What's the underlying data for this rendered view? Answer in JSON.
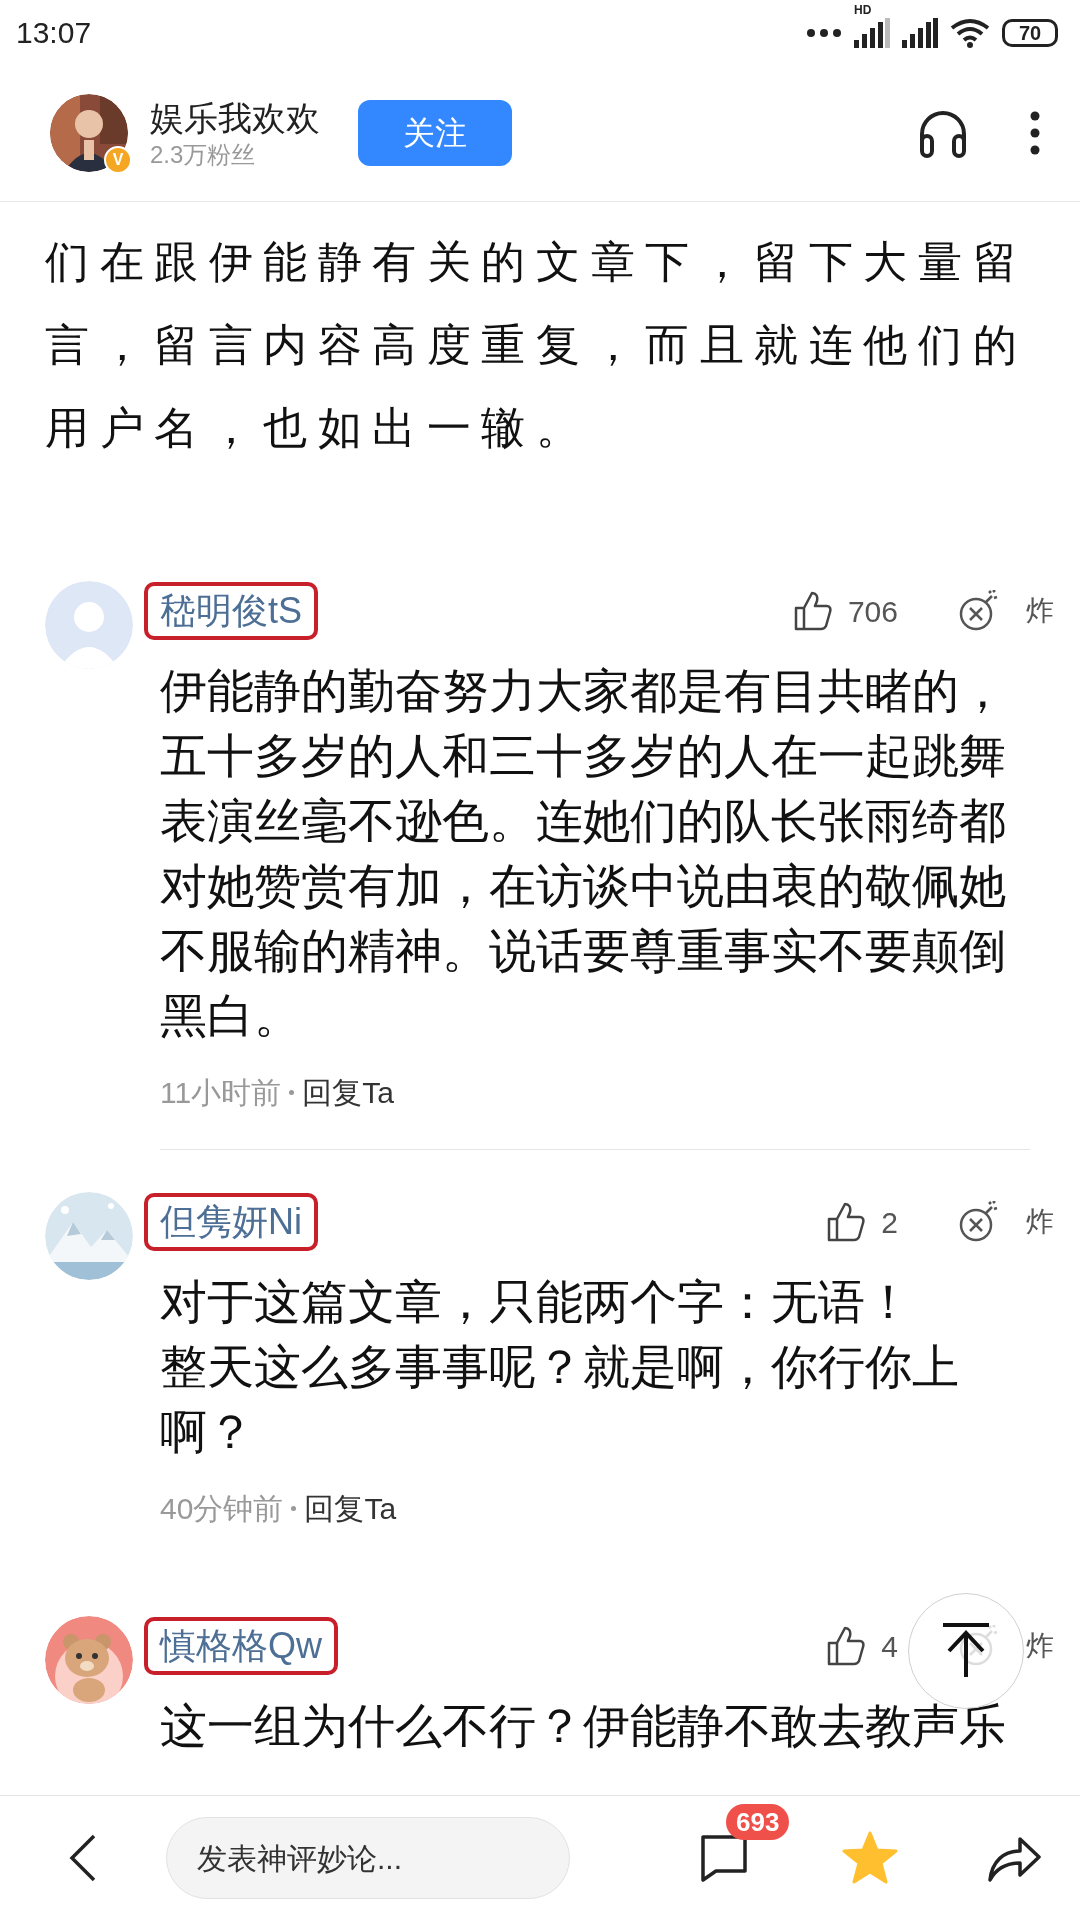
{
  "status_bar": {
    "time": "13:07",
    "network_label": "HD",
    "battery": "70"
  },
  "header": {
    "author": "娱乐我欢欢",
    "verified_badge": "V",
    "followers": "2.3万粉丝",
    "follow_button": "关注"
  },
  "article": {
    "text": "们在跟伊能静有关的文章下，留下大量留言，留言内容高度重复，而且就连他们的用户名，也如出一辙。"
  },
  "comments": [
    {
      "user": "嵇明俊tS",
      "highlighted": true,
      "avatar": {
        "kind": "default"
      },
      "likes": "706",
      "bomb_label": "炸",
      "paragraphs": [
        "伊能静的勤奋努力大家都是有目共睹的，五十多岁的人和三十多岁的人在一起跳舞表演丝毫不逊色。连她们的队长张雨绮都对她赞赏有加，在访谈中说由衷的敬佩她不服输的精神。说话要尊重事实不要颠倒黑白。"
      ],
      "time": "11小时前",
      "reply": "回复Ta",
      "divider": true
    },
    {
      "user": "但隽妍Ni",
      "highlighted": true,
      "avatar": {
        "kind": "picture"
      },
      "likes": "2",
      "bomb_label": "炸",
      "paragraphs": [
        "对于这篇文章，只能两个字：无语！",
        "整天这么多事事呢？就是啊，你行你上啊？"
      ],
      "time": "40分钟前",
      "reply": "回复Ta",
      "divider": false
    },
    {
      "user": "慎格格Qw",
      "highlighted": true,
      "avatar": {
        "kind": "bear"
      },
      "likes": "4",
      "bomb_label": "炸",
      "paragraphs": [
        "这一组为什么不行？伊能静不敢去教声乐"
      ]
    }
  ],
  "bottom_bar": {
    "placeholder": "发表神评妙论...",
    "comment_count": "693",
    "favorited": true
  }
}
